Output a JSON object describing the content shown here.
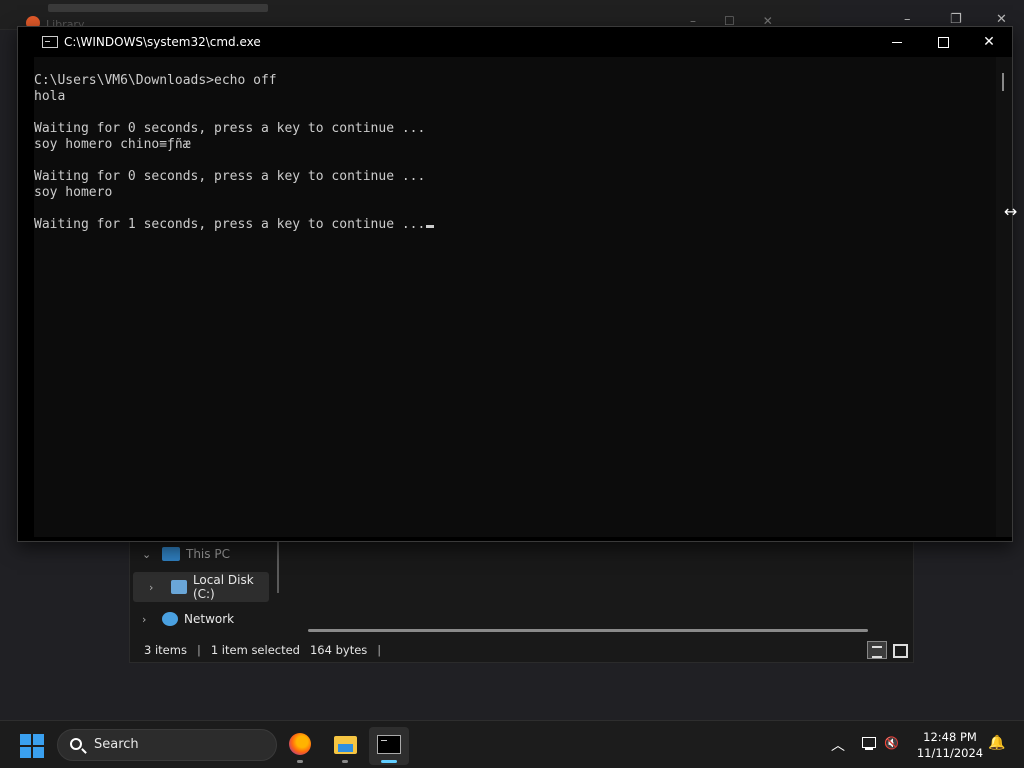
{
  "library_window": {
    "title": "Library"
  },
  "cmd": {
    "title": "C:\\WINDOWS\\system32\\cmd.exe",
    "lines": [
      "C:\\Users\\VM6\\Downloads>echo off",
      "hola",
      "",
      "Waiting for 0 seconds, press a key to continue ...",
      "soy homero chino≡ƒñæ",
      "",
      "Waiting for 0 seconds, press a key to continue ...",
      "soy homero",
      "",
      "Waiting for 1 seconds, press a key to continue ..."
    ]
  },
  "explorer": {
    "nav": {
      "this_pc": "This PC",
      "local_disk": "Local Disk (C:)",
      "network": "Network"
    },
    "status": {
      "items": "3 items",
      "selected": "1 item selected",
      "size": "164 bytes",
      "sep": "|"
    }
  },
  "taskbar": {
    "search_label": "Search",
    "time": "12:48 PM",
    "date": "11/11/2024"
  },
  "icons": {
    "start": "windows-logo-icon",
    "search": "search-icon",
    "firefox": "firefox-icon",
    "explorer": "file-explorer-icon",
    "cmd": "command-prompt-icon",
    "tray_chevron": "chevron-up-icon",
    "network": "network-disconnected-icon",
    "volume": "volume-muted-icon",
    "bell": "notification-bell-icon"
  },
  "colors": {
    "console_bg": "#0c0c0c",
    "console_fg": "#cccccc",
    "accent": "#60cdff",
    "taskbar_bg": "#1c1c1c"
  }
}
